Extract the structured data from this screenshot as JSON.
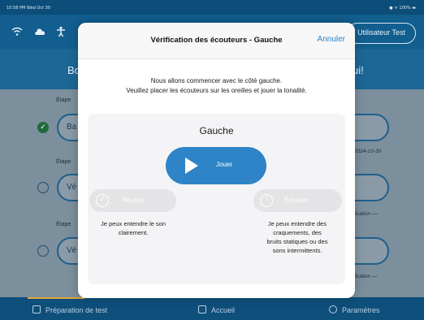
{
  "status_bar": {
    "time": "10:58 PM  Wed Oct 30",
    "battery": "● ᯤ 100% ▬"
  },
  "header": {
    "user_label": "Utilisateur Test"
  },
  "background": {
    "title_left": "Bo",
    "title_right": "ui!",
    "stage_label": "Étape",
    "rows": [
      {
        "pill_text": "Ba",
        "side_text": "- 2024-10-30"
      },
      {
        "pill_text": "Vé",
        "side_text": "rification —"
      },
      {
        "pill_text": "Vé",
        "side_text": "rification —"
      }
    ]
  },
  "tabbar": {
    "tabs": [
      {
        "label": "Préparation de test"
      },
      {
        "label": "Accueil"
      },
      {
        "label": "Paramètres"
      }
    ]
  },
  "modal": {
    "title": "Vérification des écouteurs - Gauche",
    "cancel_label": "Annuler",
    "instructions": [
      "Nous allons commencer avec le côté gauche.",
      "Veuillez placer les écouteurs sur les oreilles et jouer la tonalité."
    ],
    "side_label": "Gauche",
    "play_label": "Jouer",
    "pass_label": "Réussir",
    "fail_label": "Échouer",
    "pass_description": [
      "Je peux entendre le son",
      "clairement."
    ],
    "fail_description": [
      "Je peux entendre des",
      "craquements, des",
      "bruits statiques ou des",
      "sons intermittents."
    ]
  },
  "colors": {
    "accent": "#2e84c6",
    "header": "#115e8f",
    "disabled_button": "#e4e4e6",
    "tab_indicator": "#e3a63a"
  },
  "icons": [
    "wifi-icon",
    "cloud-icon",
    "accessibility-icon",
    "play-icon",
    "check-circle-icon",
    "alert-circle-icon",
    "clipboard-icon",
    "home-icon",
    "gear-icon"
  ]
}
